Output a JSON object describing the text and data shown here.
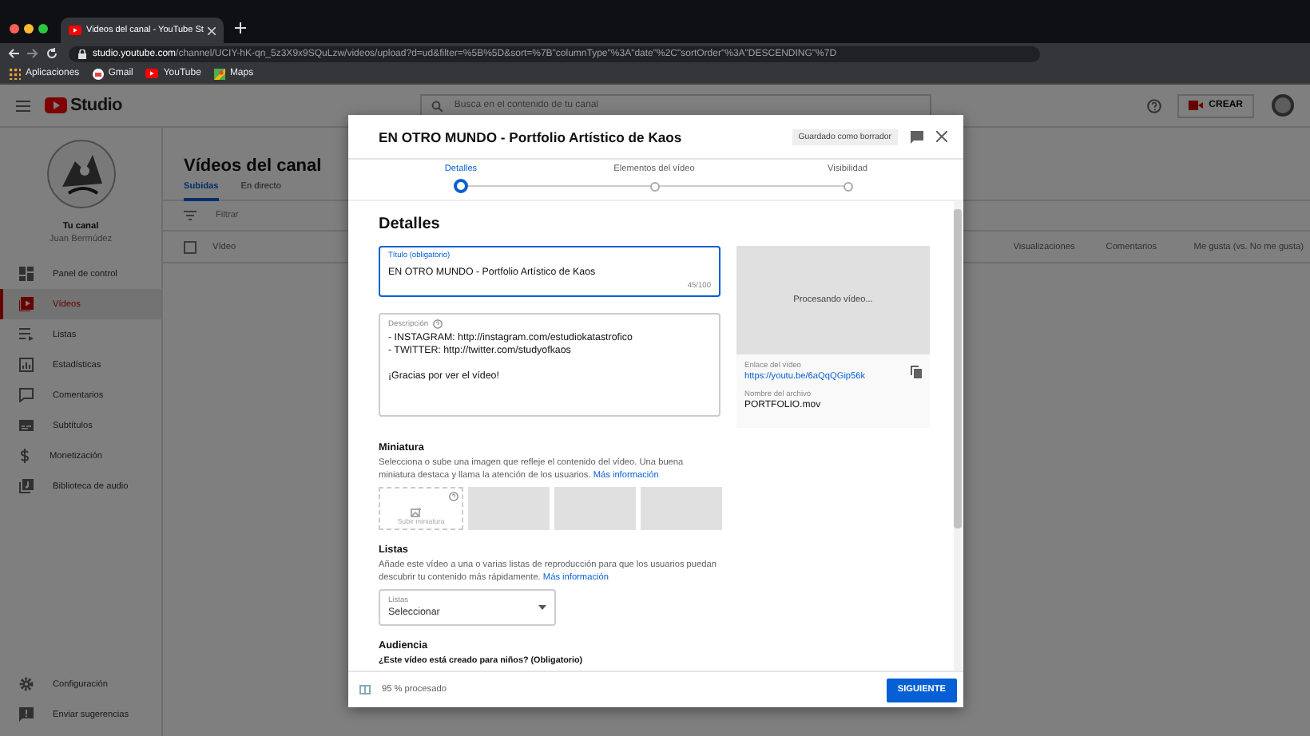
{
  "browser": {
    "tabs": [
      {
        "title": "Videos del canal - YouTube St",
        "selected": true
      }
    ],
    "url_host": "studio.youtube.com",
    "url_path": "/channel/UCIY-hK-qn_5z3X9x9SQuLzw/videos/upload?d=ud&filter=%5B%5D&sort=%7B\"columnType\"%3A\"date\"%2C\"sortOrder\"%3A\"DESCENDING\"%7D",
    "bookmarks": [
      {
        "label": "Aplicaciones",
        "kind": "apps"
      },
      {
        "label": "Gmail",
        "kind": "gmail"
      },
      {
        "label": "YouTube",
        "kind": "youtube"
      },
      {
        "label": "Maps",
        "kind": "maps"
      }
    ]
  },
  "header": {
    "logo": "Studio",
    "search": {
      "placeholder": "Busca en el contenido de tu canal"
    },
    "create_button": "CREAR"
  },
  "sidebar": {
    "channel_label": "Tu canal",
    "channel_name": "Juan Bermúdez",
    "items": [
      {
        "label": "Panel de control",
        "kind": "dashboard",
        "selected": false
      },
      {
        "label": "Vídeos",
        "kind": "videos",
        "selected": true
      },
      {
        "label": "Listas",
        "kind": "playlists",
        "selected": false
      },
      {
        "label": "Estadísticas",
        "kind": "analytics",
        "selected": false
      },
      {
        "label": "Comentarios",
        "kind": "comments",
        "selected": false
      },
      {
        "label": "Subtítulos",
        "kind": "subtitles",
        "selected": false
      },
      {
        "label": "Monetización",
        "kind": "monetization",
        "selected": false
      },
      {
        "label": "Biblioteca de audio",
        "kind": "audio",
        "selected": false
      }
    ],
    "footer_items": [
      {
        "label": "Configuración",
        "kind": "settings"
      },
      {
        "label": "Enviar sugerencias",
        "kind": "feedback"
      }
    ]
  },
  "page": {
    "title": "Vídeos del canal",
    "tabs": [
      {
        "label": "Subidas",
        "selected": true
      },
      {
        "label": "En directo",
        "selected": false
      }
    ],
    "filter": {
      "placeholder": "Filtrar"
    },
    "select_all": {
      "checked": false
    },
    "columns": [
      "Vídeo",
      "Visualizaciones",
      "Comentarios",
      "Me gusta (vs. No me gusta)"
    ]
  },
  "dialog": {
    "title": "EN OTRO MUNDO - Portfolio Artístico de Kaos",
    "draft_badge": "Guardado como borrador",
    "steps": [
      {
        "label": "Detalles",
        "selected": true
      },
      {
        "label": "Elementos del vídeo",
        "selected": false
      },
      {
        "label": "Visibilidad",
        "selected": false
      }
    ],
    "section_title": "Detalles",
    "title_field": {
      "label": "Título (obligatorio)",
      "value": "EN OTRO MUNDO - Portfolio Artístico de Kaos",
      "counter": "45/100"
    },
    "description_field": {
      "label": "Descripción",
      "value": "- INSTAGRAM: http://instagram.com/estudiokatastrofico\n- TWITTER: http://twitter.com/studyofkaos\n\n¡Gracias por ver el vídeo!"
    },
    "preview": {
      "status": "Procesando vídeo...",
      "link_label": "Enlace del vídeo",
      "link": "https://youtu.be/6aQqQGip56k",
      "file_label": "Nombre del archivo",
      "file_name": "PORTFOLIO.mov"
    },
    "thumbnail": {
      "heading": "Miniatura",
      "text": "Selecciona o sube una imagen que refleje el contenido del vídeo. Una buena miniatura destaca y llama la atención de los usuarios.",
      "link": "Más información",
      "upload_label": "Subir miniatura"
    },
    "playlists": {
      "heading": "Listas",
      "text": "Añade este vídeo a una o varias listas de reproducción para que los usuarios puedan descubrir tu contenido más rápidamente.",
      "link": "Más información",
      "select_label": "Listas",
      "select_value": "Seleccionar"
    },
    "audience": {
      "heading": "Audiencia",
      "question": "¿Este vídeo está creado para niños? (Obligatorio)"
    },
    "footer": {
      "status": "95 % procesado",
      "next_button": "SIGUIENTE"
    }
  }
}
